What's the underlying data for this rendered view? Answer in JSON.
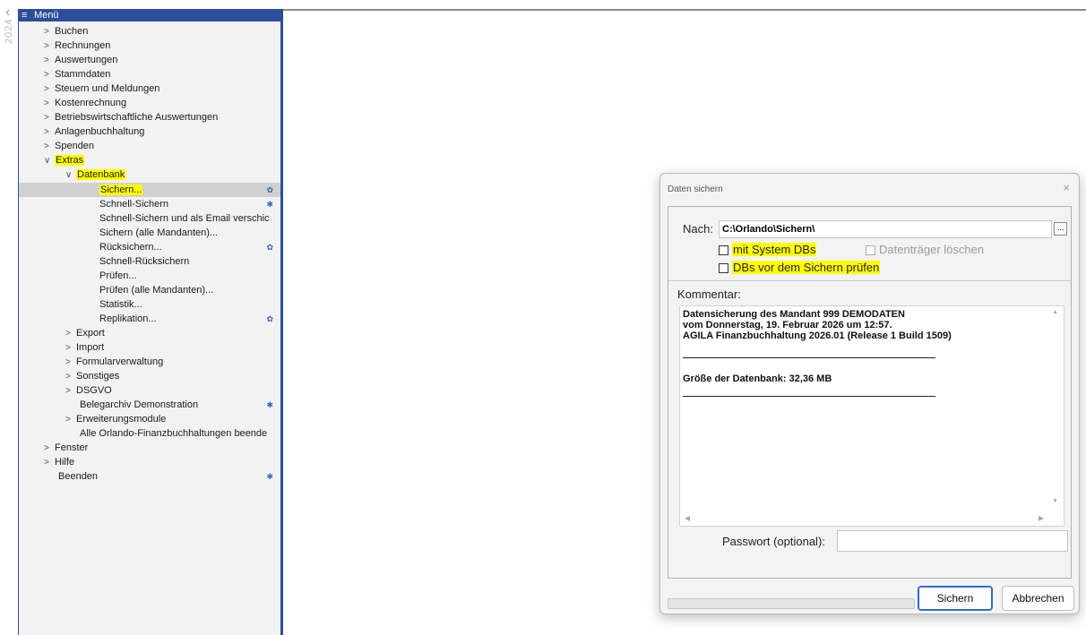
{
  "left_strip": {
    "year": "2024"
  },
  "menu": {
    "title": "Menü",
    "items": [
      {
        "label": "Buchen"
      },
      {
        "label": "Rechnungen"
      },
      {
        "label": "Auswertungen"
      },
      {
        "label": "Stammdaten"
      },
      {
        "label": "Steuern und Meldungen"
      },
      {
        "label": "Kostenrechnung"
      },
      {
        "label": "Betriebswirtschaftliche Auswertungen"
      },
      {
        "label": "Anlagenbuchhaltung"
      },
      {
        "label": "Spenden"
      },
      {
        "label": "Extras"
      },
      {
        "label": "Datenbank"
      },
      {
        "label": "Sichern..."
      },
      {
        "label": "Schnell-Sichern"
      },
      {
        "label": "Schnell-Sichern und als Email verschic"
      },
      {
        "label": "Sichern (alle Mandanten)..."
      },
      {
        "label": "Rücksichern..."
      },
      {
        "label": "Schnell-Rücksichern"
      },
      {
        "label": "Prüfen..."
      },
      {
        "label": "Prüfen (alle Mandanten)..."
      },
      {
        "label": "Statistik..."
      },
      {
        "label": "Replikation..."
      },
      {
        "label": "Export"
      },
      {
        "label": "Import"
      },
      {
        "label": "Formularverwaltung"
      },
      {
        "label": "Sonstiges"
      },
      {
        "label": "DSGVO"
      },
      {
        "label": "Belegarchiv Demonstration"
      },
      {
        "label": "Erweiterungsmodule"
      },
      {
        "label": "Alle Orlando-Finanzbuchhaltungen beende"
      },
      {
        "label": "Fenster"
      },
      {
        "label": "Hilfe"
      },
      {
        "label": "Beenden"
      }
    ]
  },
  "dialog": {
    "title": "Daten sichern",
    "close": "×",
    "nach_label": "Nach:",
    "nach_value": "C:\\Orlando\\Sichern\\",
    "browse": "...",
    "cb_system": "mit System DBs",
    "cb_clear": "Datenträger löschen",
    "cb_check": "DBs vor dem Sichern prüfen",
    "kommentar_label": "Kommentar:",
    "comment_lines": [
      "Datensicherung des Mandant 999 DEMODATEN",
      "vom Donnerstag, 19. Februar 2026 um 12:57.",
      "AGILA Finanzbuchhaltung 2026.01 (Release 1 Build 1509)",
      "Größe der Datenbank: 32,36 MB"
    ],
    "password_label": "Passwort (optional):",
    "password_value": "",
    "btn_save": "Sichern",
    "btn_cancel": "Abbrechen"
  }
}
